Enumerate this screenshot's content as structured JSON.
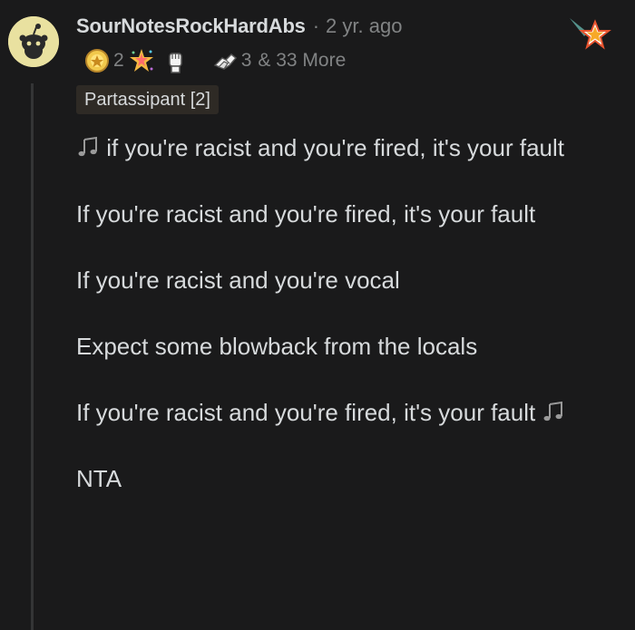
{
  "comment": {
    "username": "SourNotesRockHardAbs",
    "separator": "·",
    "timestamp": "2 yr. ago",
    "awards": [
      {
        "icon": "helpful-award-icon",
        "count": "2"
      },
      {
        "icon": "wholesome-seal-award-icon",
        "count": ""
      },
      {
        "icon": "fist-raise-award-icon",
        "count": ""
      },
      {
        "icon": "respect-award-icon",
        "count": "3"
      }
    ],
    "more_awards": "& 33 More",
    "flair": "Partassipant [2]",
    "corner_award": "shooting-star-award-icon",
    "paragraphs": [
      {
        "lead_icon": "music-note-icon",
        "text": " if you're racist and you're fired, it's your fault"
      },
      {
        "text": "If you're racist and you're fired, it's your fault"
      },
      {
        "text": "If you're racist and you're vocal"
      },
      {
        "text": "Expect some blowback from the locals"
      },
      {
        "text": "If you're racist and you're fired, it's your fault ",
        "trail_icon": "music-note-icon"
      },
      {
        "text": "NTA"
      }
    ]
  },
  "colors": {
    "background": "#1a1a1b",
    "text": "#d7dadc",
    "muted": "#818384",
    "thread_line": "#343536",
    "flair_bg": "#2e2a25",
    "avatar_bg": "#e9e1a0"
  }
}
